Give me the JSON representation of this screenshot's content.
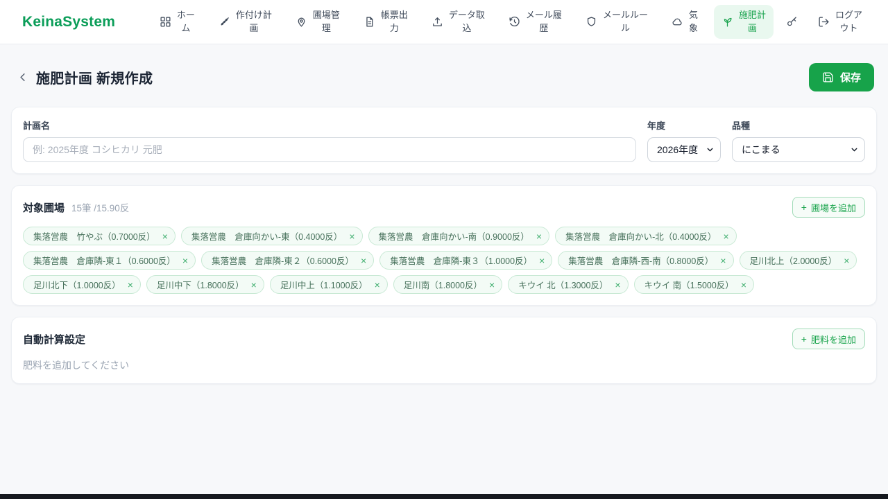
{
  "brand": "KeinaSystem",
  "ui": {
    "plus": "+",
    "close": "×"
  },
  "nav": {
    "items": [
      {
        "id": "home",
        "icon": "grid-icon",
        "label": "ホー\nム",
        "active": false
      },
      {
        "id": "planting-plan",
        "icon": "wheat-icon",
        "label": "作付け計\n画",
        "active": false
      },
      {
        "id": "field-management",
        "icon": "map-pin-icon",
        "label": "圃場管\n理",
        "active": false
      },
      {
        "id": "report-output",
        "icon": "document-icon",
        "label": "帳票出\n力",
        "active": false
      },
      {
        "id": "data-import",
        "icon": "upload-icon",
        "label": "データ取\n込",
        "active": false
      },
      {
        "id": "mail-history",
        "icon": "history-icon",
        "label": "メール履\n歴",
        "active": false
      },
      {
        "id": "mail-rules",
        "icon": "shield-icon",
        "label": "メールルー\nル",
        "active": false
      },
      {
        "id": "weather",
        "icon": "cloud-icon",
        "label": "気\n象",
        "active": false
      },
      {
        "id": "fertilization-plan",
        "icon": "sprout-icon",
        "label": "施肥計\n画",
        "active": true
      },
      {
        "id": "api-key",
        "icon": "key-icon",
        "label": "",
        "active": false
      },
      {
        "id": "logout",
        "icon": "logout-icon",
        "label": "ログア\nウト",
        "active": false
      }
    ]
  },
  "header": {
    "title": "施肥計画 新規作成",
    "save_label": "保存"
  },
  "form": {
    "plan_name_label": "計画名",
    "plan_name_placeholder": "例: 2025年度 コシヒカリ 元肥",
    "year_label": "年度",
    "year_value": "2026年度",
    "variety_label": "品種",
    "variety_value": "にこまる"
  },
  "fields_section": {
    "title": "対象圃場",
    "summary": "15筆 /15.90反",
    "add_button_label": "圃場を追加",
    "chips": [
      "集落営農　竹やぶ（0.7000反）",
      "集落営農　倉庫向かい-東（0.4000反）",
      "集落営農　倉庫向かい-南（0.9000反）",
      "集落営農　倉庫向かい-北（0.4000反）",
      "集落営農　倉庫隣-東１（0.6000反）",
      "集落営農　倉庫隣-東２（0.6000反）",
      "集落営農　倉庫隣-東３（1.0000反）",
      "集落営農　倉庫隣-西-南（0.8000反）",
      "足川北上（2.0000反）",
      "足川北下（1.0000反）",
      "足川中下（1.8000反）",
      "足川中上（1.1000反）",
      "足川南（1.8000反）",
      "キウイ 北（1.3000反）",
      "キウイ 南（1.5000反）"
    ]
  },
  "calc_section": {
    "title": "自動計算設定",
    "add_button_label": "肥料を追加",
    "empty_text": "肥料を追加してください"
  }
}
